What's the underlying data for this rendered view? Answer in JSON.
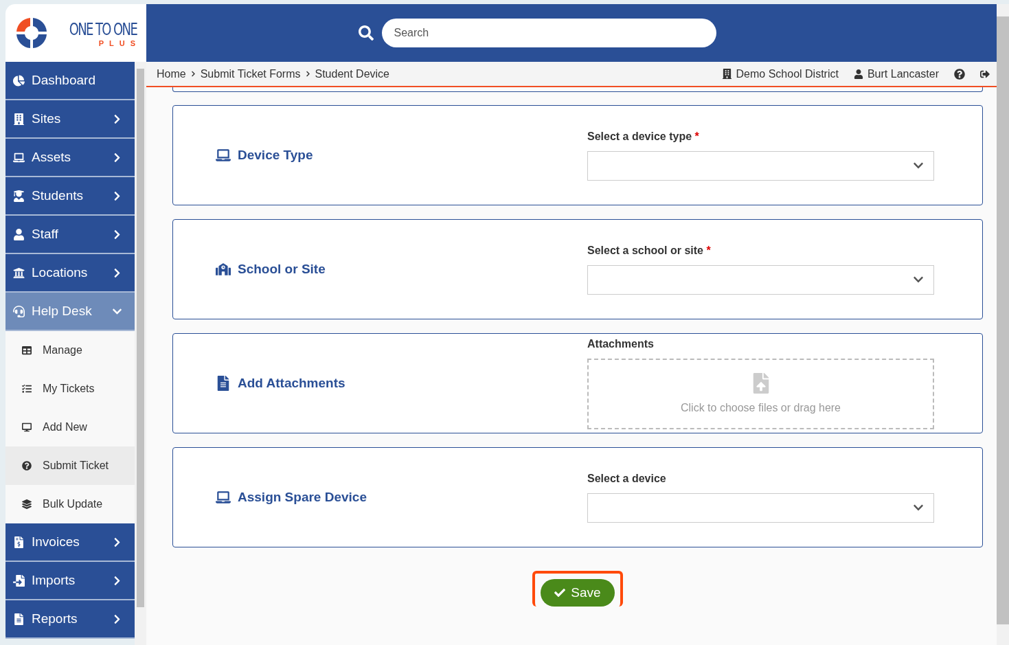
{
  "logo": {
    "name": "ONE TO ONE",
    "tagline": "PLUS"
  },
  "search": {
    "placeholder": "Search"
  },
  "sidebar": {
    "items": [
      {
        "label": "Dashboard",
        "kind": "link"
      },
      {
        "label": "Sites",
        "kind": "menu",
        "expanded": false
      },
      {
        "label": "Assets",
        "kind": "menu",
        "expanded": false
      },
      {
        "label": "Students",
        "kind": "menu",
        "expanded": false
      },
      {
        "label": "Staff",
        "kind": "menu",
        "expanded": false
      },
      {
        "label": "Locations",
        "kind": "menu",
        "expanded": false
      },
      {
        "label": "Help Desk",
        "kind": "menu",
        "expanded": true,
        "children": [
          {
            "label": "Manage",
            "selected": false
          },
          {
            "label": "My Tickets",
            "selected": false
          },
          {
            "label": "Add New",
            "selected": false
          },
          {
            "label": "Submit Ticket",
            "selected": true
          },
          {
            "label": "Bulk Update",
            "selected": false
          }
        ]
      },
      {
        "label": "Invoices",
        "kind": "menu",
        "expanded": false
      },
      {
        "label": "Imports",
        "kind": "menu",
        "expanded": false
      },
      {
        "label": "Reports",
        "kind": "menu",
        "expanded": false
      }
    ]
  },
  "breadcrumb": [
    "Home",
    "Submit Ticket Forms",
    "Student Device"
  ],
  "account": {
    "district": "Demo School District",
    "user": "Burt Lancaster"
  },
  "sections": [
    {
      "title": "Device Type",
      "field_label": "Select a device type",
      "required_mark": "*",
      "kind": "select"
    },
    {
      "title": "School or Site",
      "field_label": "Select a school or site",
      "required_mark": "*",
      "kind": "select"
    },
    {
      "title": "Add Attachments",
      "field_label": "Attachments",
      "kind": "upload",
      "hint": "Click to choose files or drag here"
    },
    {
      "title": "Assign Spare Device",
      "field_label": "Select a device",
      "kind": "select"
    }
  ],
  "save_button": {
    "label": "Save"
  }
}
